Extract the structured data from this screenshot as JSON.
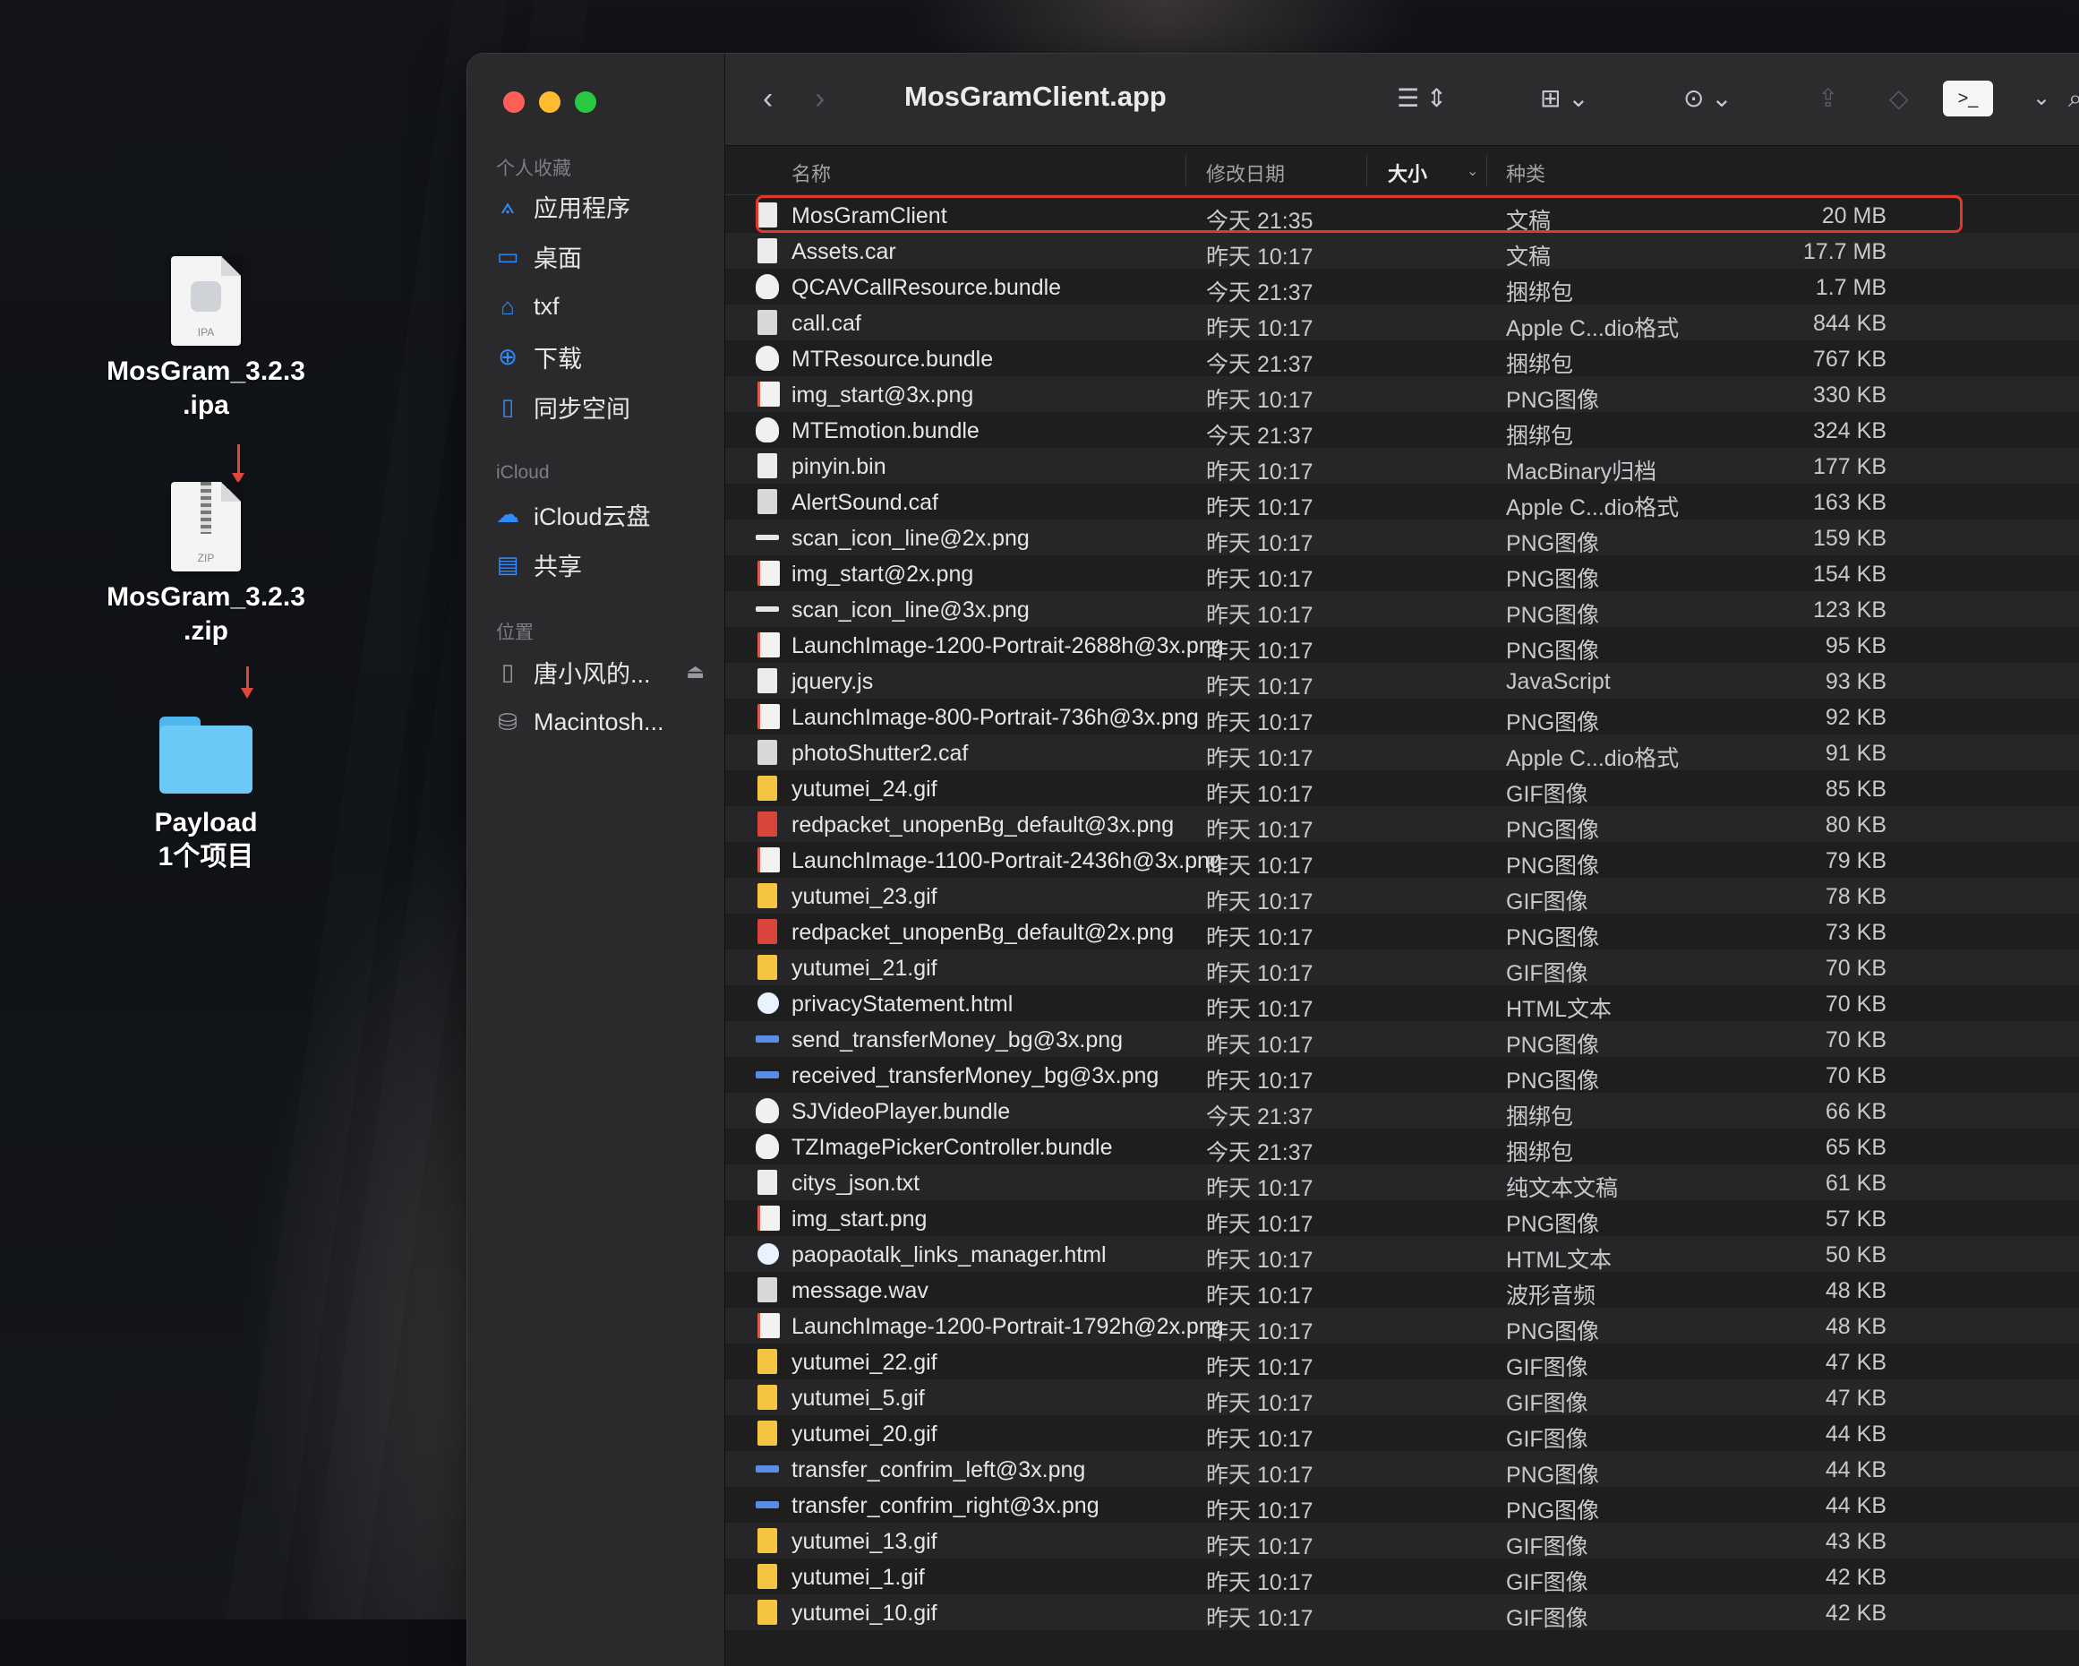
{
  "desktop": {
    "ipa": {
      "line1": "MosGram_3.2.3",
      "line2": ".ipa",
      "tag": "IPA"
    },
    "zip": {
      "line1": "MosGram_3.2.3",
      "line2": ".zip",
      "tag": "ZIP"
    },
    "folder": {
      "line1": "Payload",
      "line2": "1个项目"
    }
  },
  "window": {
    "title": "MosGramClient.app",
    "sidebar": {
      "favorites_label": "个人收藏",
      "favorites": [
        {
          "label": "应用程序",
          "icon": "apps-icon"
        },
        {
          "label": "桌面",
          "icon": "desktop-icon"
        },
        {
          "label": "txf",
          "icon": "home-icon"
        },
        {
          "label": "下载",
          "icon": "download-icon"
        },
        {
          "label": "同步空间",
          "icon": "document-icon"
        }
      ],
      "icloud_label": "iCloud",
      "icloud": [
        {
          "label": "iCloud云盘",
          "icon": "cloud-icon"
        },
        {
          "label": "共享",
          "icon": "shared-folder-icon"
        }
      ],
      "locations_label": "位置",
      "locations": [
        {
          "label": "唐小风的...",
          "icon": "phone-icon"
        },
        {
          "label": "Macintosh...",
          "icon": "disk-icon"
        }
      ]
    },
    "columns": {
      "name": "名称",
      "date": "修改日期",
      "size": "大小",
      "kind": "种类"
    },
    "files": [
      {
        "name": "MosGramClient",
        "date": "今天 21:35",
        "size": "20 MB",
        "kind": "文稿",
        "icon": "doc"
      },
      {
        "name": "Assets.car",
        "date": "昨天 10:17",
        "size": "17.7 MB",
        "kind": "文稿",
        "icon": "doc"
      },
      {
        "name": "QCAVCallResource.bundle",
        "date": "今天 21:37",
        "size": "1.7 MB",
        "kind": "捆绑包",
        "icon": "bundle"
      },
      {
        "name": "call.caf",
        "date": "昨天 10:17",
        "size": "844 KB",
        "kind": "Apple C...dio格式",
        "icon": "audio"
      },
      {
        "name": "MTResource.bundle",
        "date": "今天 21:37",
        "size": "767 KB",
        "kind": "捆绑包",
        "icon": "bundle"
      },
      {
        "name": "img_start@3x.png",
        "date": "昨天 10:17",
        "size": "330 KB",
        "kind": "PNG图像",
        "icon": "img"
      },
      {
        "name": "MTEmotion.bundle",
        "date": "今天 21:37",
        "size": "324 KB",
        "kind": "捆绑包",
        "icon": "bundle"
      },
      {
        "name": "pinyin.bin",
        "date": "昨天 10:17",
        "size": "177 KB",
        "kind": "MacBinary归档",
        "icon": "doc"
      },
      {
        "name": "AlertSound.caf",
        "date": "昨天 10:17",
        "size": "163 KB",
        "kind": "Apple C...dio格式",
        "icon": "audio"
      },
      {
        "name": "scan_icon_line@2x.png",
        "date": "昨天 10:17",
        "size": "159 KB",
        "kind": "PNG图像",
        "icon": "line"
      },
      {
        "name": "img_start@2x.png",
        "date": "昨天 10:17",
        "size": "154 KB",
        "kind": "PNG图像",
        "icon": "img"
      },
      {
        "name": "scan_icon_line@3x.png",
        "date": "昨天 10:17",
        "size": "123 KB",
        "kind": "PNG图像",
        "icon": "line"
      },
      {
        "name": "LaunchImage-1200-Portrait-2688h@3x.png",
        "date": "昨天 10:17",
        "size": "95 KB",
        "kind": "PNG图像",
        "icon": "img"
      },
      {
        "name": "jquery.js",
        "date": "昨天 10:17",
        "size": "93 KB",
        "kind": "JavaScript",
        "icon": "doc"
      },
      {
        "name": "LaunchImage-800-Portrait-736h@3x.png",
        "date": "昨天 10:17",
        "size": "92 KB",
        "kind": "PNG图像",
        "icon": "img"
      },
      {
        "name": "photoShutter2.caf",
        "date": "昨天 10:17",
        "size": "91 KB",
        "kind": "Apple C...dio格式",
        "icon": "audio"
      },
      {
        "name": "yutumei_24.gif",
        "date": "昨天 10:17",
        "size": "85 KB",
        "kind": "GIF图像",
        "icon": "gif"
      },
      {
        "name": "redpacket_unopenBg_default@3x.png",
        "date": "昨天 10:17",
        "size": "80 KB",
        "kind": "PNG图像",
        "icon": "red"
      },
      {
        "name": "LaunchImage-1100-Portrait-2436h@3x.png",
        "date": "昨天 10:17",
        "size": "79 KB",
        "kind": "PNG图像",
        "icon": "img"
      },
      {
        "name": "yutumei_23.gif",
        "date": "昨天 10:17",
        "size": "78 KB",
        "kind": "GIF图像",
        "icon": "gif"
      },
      {
        "name": "redpacket_unopenBg_default@2x.png",
        "date": "昨天 10:17",
        "size": "73 KB",
        "kind": "PNG图像",
        "icon": "red"
      },
      {
        "name": "yutumei_21.gif",
        "date": "昨天 10:17",
        "size": "70 KB",
        "kind": "GIF图像",
        "icon": "gif"
      },
      {
        "name": "privacyStatement.html",
        "date": "昨天 10:17",
        "size": "70 KB",
        "kind": "HTML文本",
        "icon": "html"
      },
      {
        "name": "send_transferMoney_bg@3x.png",
        "date": "昨天 10:17",
        "size": "70 KB",
        "kind": "PNG图像",
        "icon": "blue"
      },
      {
        "name": "received_transferMoney_bg@3x.png",
        "date": "昨天 10:17",
        "size": "70 KB",
        "kind": "PNG图像",
        "icon": "blue"
      },
      {
        "name": "SJVideoPlayer.bundle",
        "date": "今天 21:37",
        "size": "66 KB",
        "kind": "捆绑包",
        "icon": "bundle"
      },
      {
        "name": "TZImagePickerController.bundle",
        "date": "今天 21:37",
        "size": "65 KB",
        "kind": "捆绑包",
        "icon": "bundle"
      },
      {
        "name": "citys_json.txt",
        "date": "昨天 10:17",
        "size": "61 KB",
        "kind": "纯文本文稿",
        "icon": "doc"
      },
      {
        "name": "img_start.png",
        "date": "昨天 10:17",
        "size": "57 KB",
        "kind": "PNG图像",
        "icon": "img"
      },
      {
        "name": "paopaotalk_links_manager.html",
        "date": "昨天 10:17",
        "size": "50 KB",
        "kind": "HTML文本",
        "icon": "html"
      },
      {
        "name": "message.wav",
        "date": "昨天 10:17",
        "size": "48 KB",
        "kind": "波形音频",
        "icon": "audio"
      },
      {
        "name": "LaunchImage-1200-Portrait-1792h@2x.png",
        "date": "昨天 10:17",
        "size": "48 KB",
        "kind": "PNG图像",
        "icon": "img"
      },
      {
        "name": "yutumei_22.gif",
        "date": "昨天 10:17",
        "size": "47 KB",
        "kind": "GIF图像",
        "icon": "gif"
      },
      {
        "name": "yutumei_5.gif",
        "date": "昨天 10:17",
        "size": "47 KB",
        "kind": "GIF图像",
        "icon": "gif"
      },
      {
        "name": "yutumei_20.gif",
        "date": "昨天 10:17",
        "size": "44 KB",
        "kind": "GIF图像",
        "icon": "gif"
      },
      {
        "name": "transfer_confrim_left@3x.png",
        "date": "昨天 10:17",
        "size": "44 KB",
        "kind": "PNG图像",
        "icon": "blue"
      },
      {
        "name": "transfer_confrim_right@3x.png",
        "date": "昨天 10:17",
        "size": "44 KB",
        "kind": "PNG图像",
        "icon": "blue"
      },
      {
        "name": "yutumei_13.gif",
        "date": "昨天 10:17",
        "size": "43 KB",
        "kind": "GIF图像",
        "icon": "gif"
      },
      {
        "name": "yutumei_1.gif",
        "date": "昨天 10:17",
        "size": "42 KB",
        "kind": "GIF图像",
        "icon": "gif"
      },
      {
        "name": "yutumei_10.gif",
        "date": "昨天 10:17",
        "size": "42 KB",
        "kind": "GIF图像",
        "icon": "gif"
      }
    ],
    "highlighted_file_index": 0
  }
}
